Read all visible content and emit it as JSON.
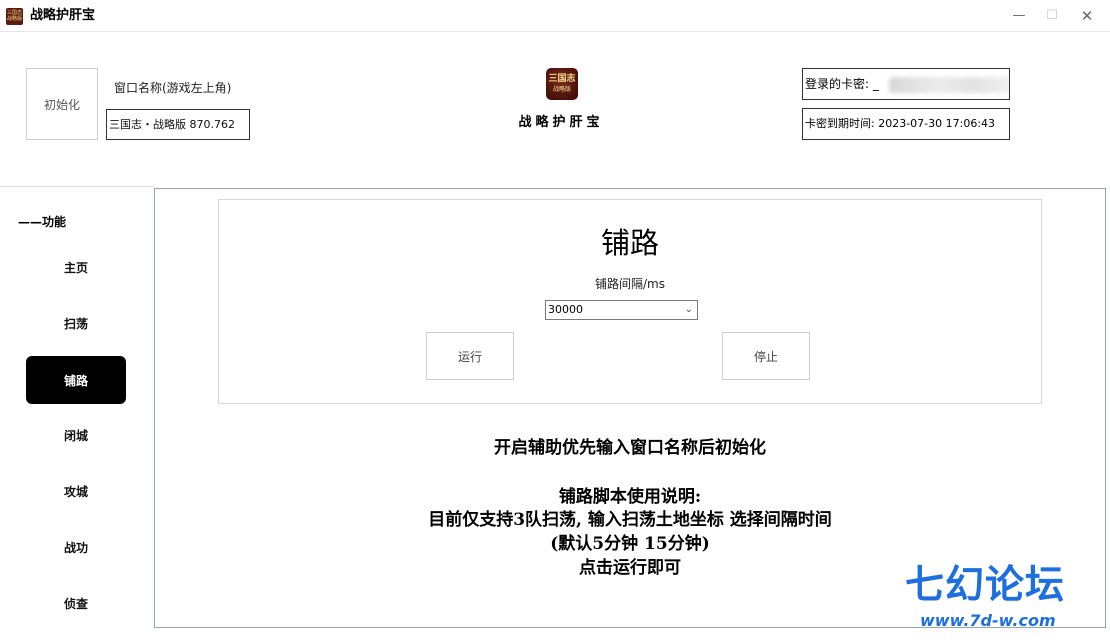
{
  "window": {
    "title": "战略护肝宝",
    "icon_name": "app-logo-icon",
    "icon_text_top": "三国志",
    "icon_text_bottom": "战略版",
    "controls": {
      "minimize": "—",
      "maximize": "☐",
      "close": "✕"
    }
  },
  "header": {
    "init_button": "初始化",
    "window_name_label": "窗口名称(游戏左上角)",
    "window_name_value": "三国志・战略版 870.762",
    "center_logo_top": "三国志",
    "center_logo_bottom": "战略版",
    "center_title": "战略护肝宝",
    "card_key_label": "登录的卡密:",
    "card_key_value_partial": "_",
    "expiry_label": "卡密到期时间:",
    "expiry_value": "2023-07-30 17:06:43"
  },
  "sidebar": {
    "section_header": "——功能",
    "items": [
      {
        "label": "主页",
        "active": false
      },
      {
        "label": "扫荡",
        "active": false
      },
      {
        "label": "铺路",
        "active": true
      },
      {
        "label": "闭城",
        "active": false
      },
      {
        "label": "攻城",
        "active": false
      },
      {
        "label": "战功",
        "active": false
      },
      {
        "label": "侦查",
        "active": false
      }
    ]
  },
  "main": {
    "feature_title": "铺路",
    "interval_label": "铺路间隔/ms",
    "interval_value": "30000",
    "run_button": "运行",
    "stop_button": "停止",
    "instructions": {
      "line1": "开启辅助优先输入窗口名称后初始化",
      "line2": "铺路脚本使用说明:",
      "line3": "目前仅支持3队扫荡, 输入扫荡土地坐标 选择间隔时间",
      "line4": "(默认5分钟 15分钟)",
      "line5": "点击运行即可"
    }
  },
  "watermark": {
    "main": "七幻论坛",
    "url": "www.7d-w.com"
  },
  "colors": {
    "active_nav_bg": "#000000",
    "panel_border": "#8fa6b3",
    "watermark": "#1d6fe0"
  }
}
